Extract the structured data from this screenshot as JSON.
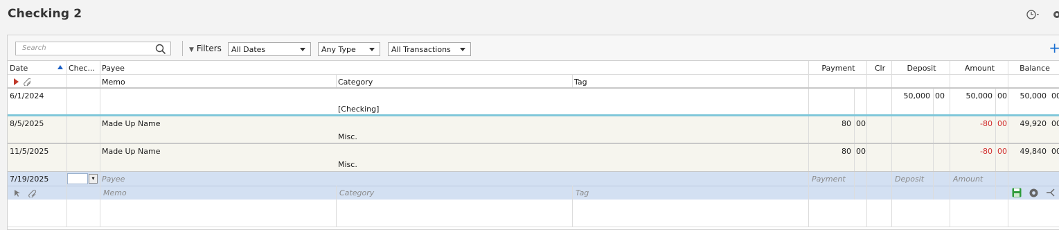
{
  "page_title": "Checking 2",
  "toolbar": {
    "search_placeholder": "Search",
    "filters_label": "Filters",
    "date_filter": "All Dates",
    "type_filter": "Any Type",
    "txn_filter": "All Transactions"
  },
  "columns": {
    "date": "Date",
    "check": "Chec...",
    "payee": "Payee",
    "payment": "Payment",
    "clr": "Clr",
    "deposit": "Deposit",
    "amount": "Amount",
    "balance": "Balance",
    "memo": "Memo",
    "category": "Category",
    "tag": "Tag"
  },
  "transactions": [
    {
      "date": "6/1/2024",
      "payee": "",
      "category": "[Checking]",
      "payment": "",
      "payment_c": "",
      "deposit": "50,000",
      "deposit_c": "00",
      "amount": "50,000",
      "amount_c": "00",
      "balance": "50,000",
      "balance_c": "00"
    },
    {
      "date": "8/5/2025",
      "payee": "Made Up Name",
      "category": "Misc.",
      "payment": "80",
      "payment_c": "00",
      "deposit": "",
      "deposit_c": "",
      "amount": "-80",
      "amount_c": "00",
      "balance": "49,920",
      "balance_c": "00"
    },
    {
      "date": "11/5/2025",
      "payee": "Made Up Name",
      "category": "Misc.",
      "payment": "80",
      "payment_c": "00",
      "deposit": "",
      "deposit_c": "",
      "amount": "-80",
      "amount_c": "00",
      "balance": "49,840",
      "balance_c": "00"
    }
  ],
  "new_entry": {
    "date": "7/19/2025",
    "payee_placeholder": "Payee",
    "payment_placeholder": "Payment",
    "deposit_placeholder": "Deposit",
    "amount_placeholder": "Amount",
    "memo_placeholder": "Memo",
    "category_placeholder": "Category",
    "tag_placeholder": "Tag"
  },
  "colors": {
    "accent": "#1a6fd1",
    "negative": "#d12a2a",
    "edit_row": "#d3e0f2",
    "divider": "#7fc7d9"
  }
}
